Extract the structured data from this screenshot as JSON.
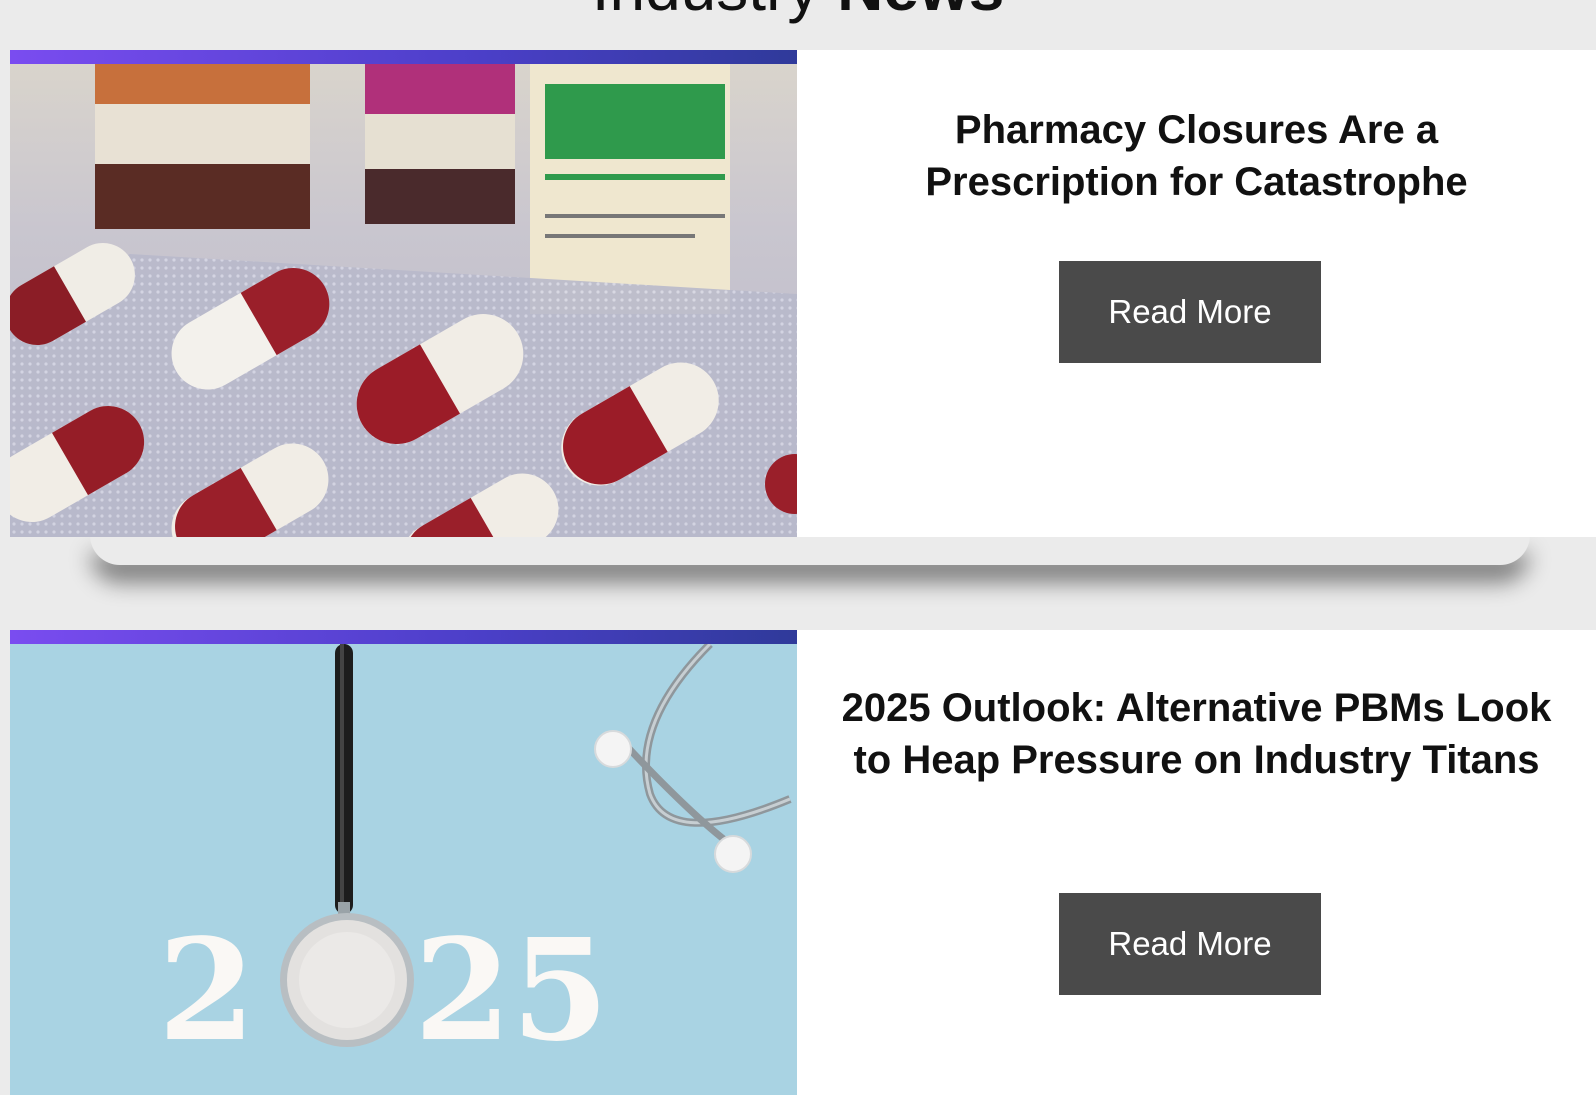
{
  "section": {
    "title_light": "Industry",
    "title_bold": "News"
  },
  "articles": [
    {
      "headline": "Pharmacy Closures Are a Prescription for Catastrophe",
      "button_label": "Read More",
      "image": "capsules-blister-pack-image"
    },
    {
      "headline": "2025 Outlook: Alternative PBMs Look to Heap Pressure on Industry Titans",
      "button_label": "Read More",
      "image": "stethoscope-2025-image",
      "image_text": "2025"
    }
  ],
  "colors": {
    "page_background": "#ebebeb",
    "button_background": "#4a4a4a",
    "accent_gradient_start": "#7a4cf0",
    "accent_gradient_end": "#2f3a9a",
    "image2_background": "#a9d3e3"
  }
}
